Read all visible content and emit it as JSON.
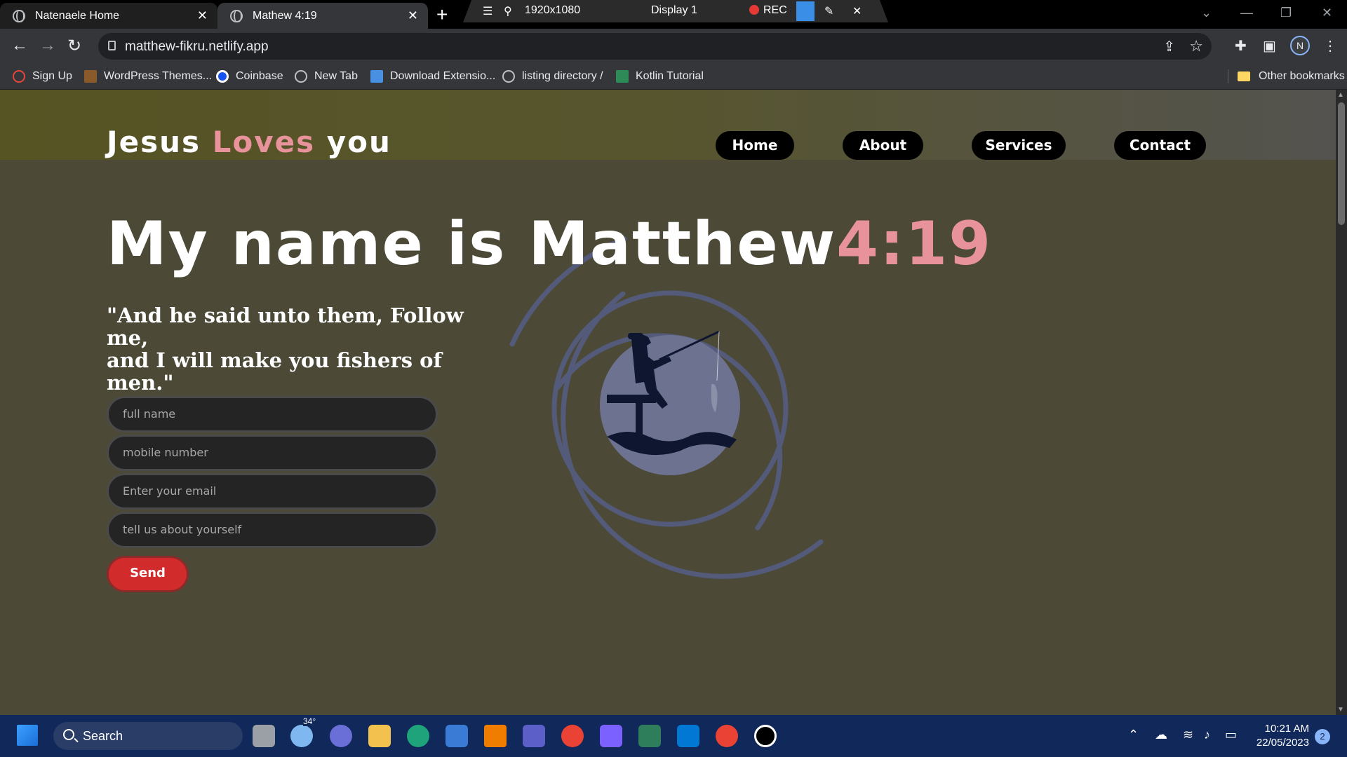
{
  "browser": {
    "tabs": [
      {
        "label": "Natenaele Home",
        "active": false
      },
      {
        "label": "Mathew 4:19",
        "active": true
      }
    ],
    "new_tab_label": "+",
    "recorder": {
      "resolution": "1920x1080",
      "display": "Display 1",
      "rec_label": "REC"
    },
    "url": "matthew-fikru.netlify.app",
    "profile_initial": "N",
    "bookmarks": [
      {
        "label": "Sign Up",
        "icon": "sign-up-icon"
      },
      {
        "label": "WordPress Themes...",
        "icon": "wordpress-icon"
      },
      {
        "label": "Coinbase",
        "icon": "coinbase-icon"
      },
      {
        "label": "New Tab",
        "icon": "globe-icon"
      },
      {
        "label": "Download Extensio...",
        "icon": "extension-icon"
      },
      {
        "label": "listing directory /",
        "icon": "globe-icon"
      },
      {
        "label": "Kotlin Tutorial",
        "icon": "kotlin-icon"
      }
    ],
    "other_bookmarks": "Other bookmarks"
  },
  "site": {
    "logo": {
      "part1": "Jesus ",
      "part2": "Loves",
      "part3": " you"
    },
    "nav": [
      "Home",
      "About",
      "Services",
      "Contact"
    ],
    "hero": {
      "main": "My name is Matthew",
      "accent": "4:19"
    },
    "quote_line1": "\"And he said unto them, Follow me,",
    "quote_line2": "and I will make you fishers of men.\"",
    "form": {
      "full_name_placeholder": "full name",
      "mobile_placeholder": "mobile number",
      "email_placeholder": "Enter your email",
      "about_placeholder": "tell us about yourself",
      "send_label": "Send"
    },
    "colors": {
      "accent": "#e8939b",
      "background": "#4c4a37",
      "send": "#d22b2b"
    }
  },
  "taskbar": {
    "search_label": "Search",
    "weather_temp": "34°",
    "time": "10:21 AM",
    "date": "22/05/2023",
    "notification_count": "2"
  }
}
